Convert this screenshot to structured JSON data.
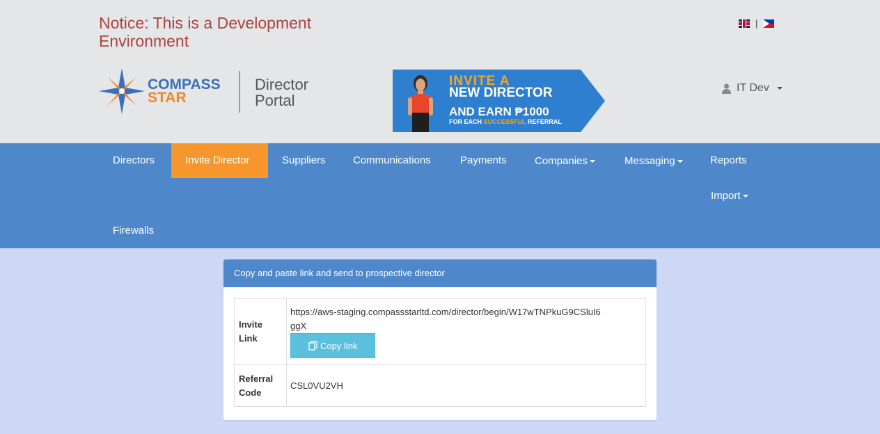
{
  "header": {
    "notice": "Notice: This is a Development Environment",
    "lang_separator": "|",
    "logo": {
      "line1": "COMPASS",
      "line2": "STAR"
    },
    "portal": {
      "line1": "Director",
      "line2": "Portal"
    },
    "banner": {
      "line1": "INVITE A",
      "line2": "NEW DIRECTOR",
      "line3": "AND EARN ₱1000",
      "line4_pre": "FOR EACH ",
      "line4_highlight": "SUCCESSFUL",
      "line4_post": " REFERRAL"
    },
    "user": {
      "name": "IT Dev",
      "icon": "user-icon"
    }
  },
  "nav": {
    "items": [
      {
        "label": "Directors"
      },
      {
        "label": "Invite Director",
        "active": true
      },
      {
        "label": "Suppliers"
      },
      {
        "label": "Communications"
      },
      {
        "label": "Payments"
      },
      {
        "label": "Companies",
        "dropdown": true
      },
      {
        "label": "Messaging",
        "dropdown": true
      },
      {
        "label": "Reports"
      },
      {
        "label": "Import",
        "dropdown": true
      },
      {
        "label": "Firewalls"
      }
    ]
  },
  "panel": {
    "heading": "Copy and paste link and send to prospective director",
    "invite_link_label": "Invite Link",
    "invite_link": "https://aws-staging.compassstarltd.com/director/begin/W17wTNPkuG9CSluI6ggX",
    "copy_button": "Copy link",
    "referral_code_label": "Referral Code",
    "referral_code": "CSL0VU2VH"
  },
  "colors": {
    "nav_bg": "#4f88ca",
    "nav_active": "#f7962c",
    "content_bg": "#cdd7f6",
    "notice_text": "#a9443f",
    "copy_button": "#5bc0de"
  }
}
